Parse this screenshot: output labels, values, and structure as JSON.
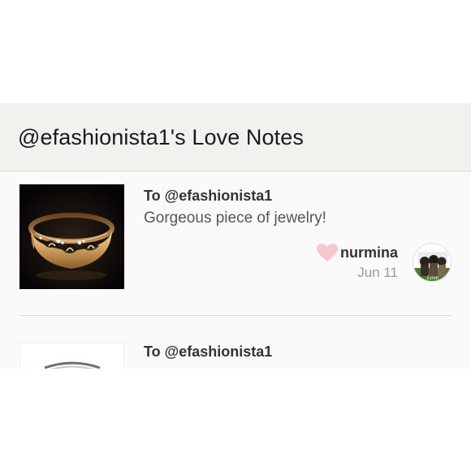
{
  "header": {
    "title": "@efashionista1's Love Notes"
  },
  "notes": [
    {
      "to": "To @efashionista1",
      "message": "Gorgeous piece of jewelry!",
      "from_user": "nurmina",
      "date": "Jun 11",
      "thumbnail_icon": "gold-ring-image",
      "avatar_icon": "user-avatar-image",
      "heart_color": "#f7c6d0"
    },
    {
      "to": "To @efashionista1",
      "thumbnail_icon": "silver-ring-image"
    }
  ],
  "colors": {
    "header_bg": "#f3f1ee",
    "list_bg": "#fafafa",
    "heart": "#f7c6d0",
    "title_text": "#1a1a1a",
    "date_text": "#999999"
  }
}
